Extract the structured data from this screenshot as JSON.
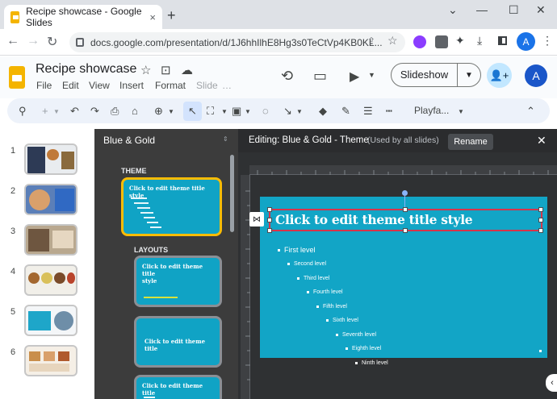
{
  "browser": {
    "tab_title": "Recipe showcase - Google Slides",
    "tab_close": "×",
    "new_tab": "+",
    "window_controls": [
      "⌄",
      "—",
      "☐",
      "✕"
    ],
    "url": "docs.google.com/presentation/d/1J6hhIlhE8Hg3s0TeCtVp4KB0KL...",
    "profile_initial": "A"
  },
  "app": {
    "doc_title": "Recipe showcase",
    "menu": [
      "File",
      "Edit",
      "View",
      "Insert",
      "Format",
      "Slide",
      "…"
    ],
    "slideshow_label": "Slideshow",
    "avatar_initial": "A"
  },
  "toolbar": {
    "font": "Playfa..."
  },
  "filmstrip": {
    "slides": [
      {
        "number": "1"
      },
      {
        "number": "2"
      },
      {
        "number": "3"
      },
      {
        "number": "4"
      },
      {
        "number": "5"
      },
      {
        "number": "6"
      }
    ]
  },
  "theme_panel": {
    "title": "Blue & Gold",
    "theme_label": "THEME",
    "layouts_label": "LAYOUTS",
    "card_title": "Click to edit theme title style",
    "card_title_short": "Click to edit theme title",
    "card_title_end": "style"
  },
  "editor": {
    "heading": "Editing: Blue & Gold - Theme",
    "subheading": "(Used by all slides)",
    "rename": "Rename",
    "close": "✕",
    "title_placeholder": "Click to edit theme title style",
    "levels": [
      "First level",
      "Second level",
      "Third level",
      "Fourth level",
      "Fifth level",
      "Sixth level",
      "Seventh level",
      "Eighth level",
      "Ninth level"
    ]
  }
}
